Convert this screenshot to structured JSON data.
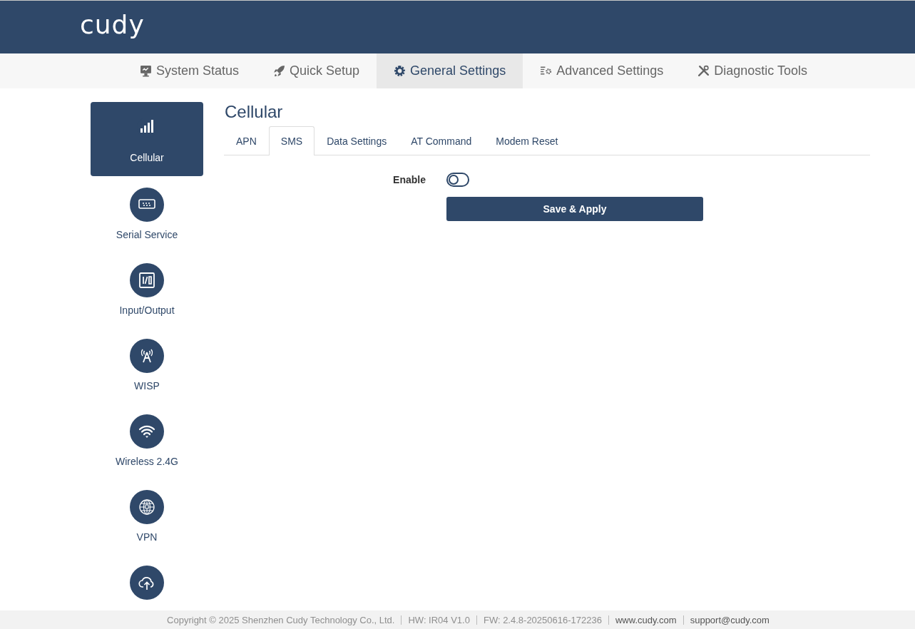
{
  "header": {
    "logo": "cudy"
  },
  "nav_tabs": [
    {
      "label": "System Status",
      "selected": false
    },
    {
      "label": "Quick Setup",
      "selected": false
    },
    {
      "label": "General Settings",
      "selected": true
    },
    {
      "label": "Advanced Settings",
      "selected": false
    },
    {
      "label": "Diagnostic Tools",
      "selected": false
    }
  ],
  "sidebar": {
    "items": [
      {
        "label": "Cellular",
        "selected": true
      },
      {
        "label": "Serial Service",
        "selected": false
      },
      {
        "label": "Input/Output",
        "selected": false
      },
      {
        "label": "WISP",
        "selected": false
      },
      {
        "label": "Wireless 2.4G",
        "selected": false
      },
      {
        "label": "VPN",
        "selected": false
      },
      {
        "selected": false
      }
    ]
  },
  "page": {
    "title": "Cellular",
    "tabs": [
      {
        "label": "APN",
        "selected": false
      },
      {
        "label": "SMS",
        "selected": true
      },
      {
        "label": "Data Settings",
        "selected": false
      },
      {
        "label": "AT Command",
        "selected": false
      },
      {
        "label": "Modem Reset",
        "selected": false
      }
    ],
    "form": {
      "enable": {
        "label": "Enable",
        "on": false
      }
    },
    "save_button": "Save & Apply"
  },
  "footer": {
    "items": [
      {
        "kind": "info",
        "text": "Copyright © 2025 Shenzhen Cudy Technology Co., Ltd."
      },
      {
        "kind": "info",
        "text": "HW: IR04 V1.0"
      },
      {
        "kind": "info",
        "text": "FW: 2.4.8-20250616-172236"
      },
      {
        "kind": "link",
        "text": "www.cudy.com"
      },
      {
        "kind": "link",
        "text": "support@cudy.com"
      }
    ]
  }
}
